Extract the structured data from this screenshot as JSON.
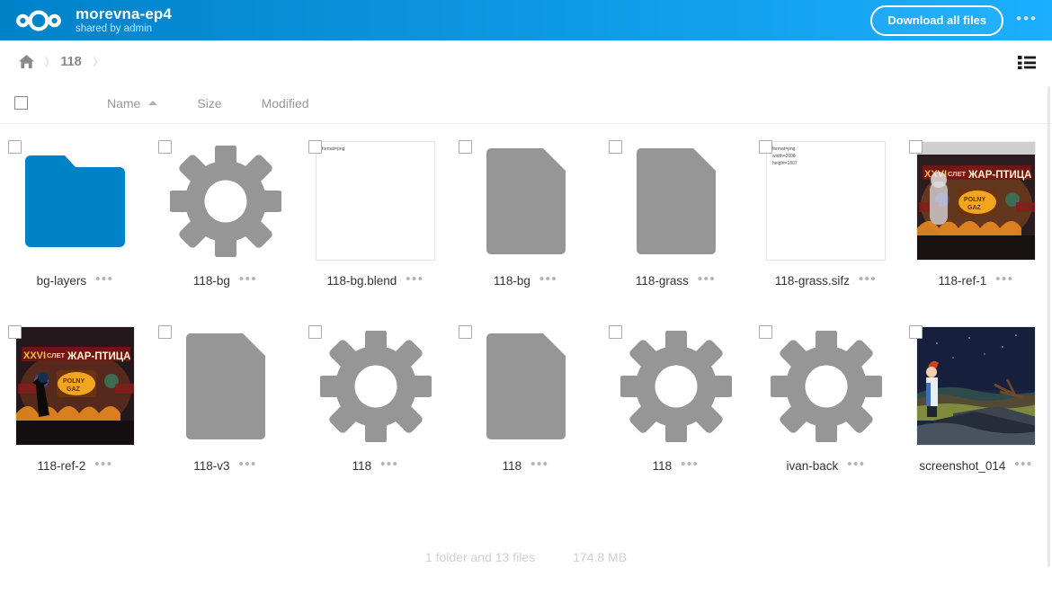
{
  "header": {
    "logo": "nextcloud-logo",
    "title": "morevna-ep4",
    "subtitle": "shared by admin",
    "download_label": "Download all files",
    "menu_glyph": "•••",
    "gradient_from": "#0082c9",
    "gradient_to": "#1cafff"
  },
  "breadcrumb": {
    "home_icon": "home-icon",
    "separator": "›",
    "items": [
      {
        "label": "118"
      }
    ],
    "view_toggle_icon": "list-view-icon"
  },
  "table_header": {
    "select_all": "",
    "name": "Name",
    "sort_direction": "ascending",
    "size": "Size",
    "modified": "Modified"
  },
  "files": [
    {
      "name": "bg-layers",
      "icon": "folder",
      "dots": "•••"
    },
    {
      "name": "118-bg",
      "icon": "gear",
      "dots": "•••"
    },
    {
      "name": "118-bg.blend",
      "icon": "text-preview",
      "preview_lines": [
        "format=png"
      ],
      "dots": "•••"
    },
    {
      "name": "118-bg",
      "icon": "document",
      "dots": "•••"
    },
    {
      "name": "118-grass",
      "icon": "document",
      "dots": "•••"
    },
    {
      "name": "118-grass.sifz",
      "icon": "text-preview",
      "preview_lines": [
        "format=png",
        "width=2008",
        "height=1607"
      ],
      "dots": "•••"
    },
    {
      "name": "118-ref-1",
      "icon": "image-stage-bright",
      "dots": "•••"
    },
    {
      "name": "118-ref-2",
      "icon": "image-stage-dark",
      "dots": "•••"
    },
    {
      "name": "118-v3",
      "icon": "document",
      "dots": "•••"
    },
    {
      "name": "118",
      "icon": "gear",
      "dots": "•••"
    },
    {
      "name": "118",
      "icon": "document",
      "dots": "•••"
    },
    {
      "name": "118",
      "icon": "gear",
      "dots": "•••"
    },
    {
      "name": "ivan-back",
      "icon": "gear",
      "dots": "•••"
    },
    {
      "name": "screenshot_014",
      "icon": "image-night",
      "dots": "•••"
    }
  ],
  "footer": {
    "count": "1 folder and 13 files",
    "size": "174.8 MB"
  },
  "colors": {
    "folder": "#0082c9",
    "file_gray": "#969696",
    "accent": "#0082c9"
  }
}
